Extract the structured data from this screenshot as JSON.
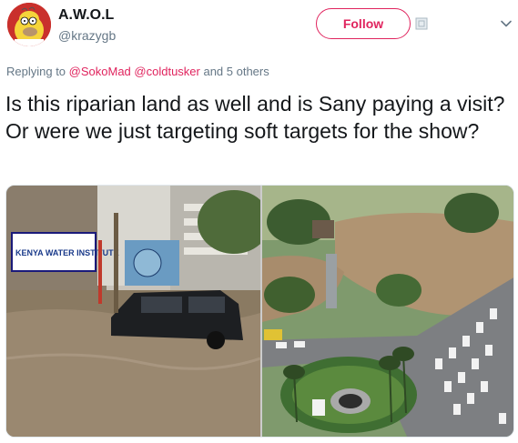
{
  "user": {
    "name": "A.W.O.L",
    "handle": "@krazygb"
  },
  "follow_label": "Follow",
  "reply": {
    "prefix": "Replying to ",
    "mention1": "@SokoMad",
    "mention2": "@coldtusker",
    "suffix": " and 5 others"
  },
  "tweet_text": "Is this riparian land as well and is Sany paying a visit? Or were we just targeting soft targets for the show?",
  "media": {
    "left_photo": {
      "sign_text": "KENYA WATER INSTITUTE"
    },
    "right_photo": {}
  },
  "colors": {
    "accent": "#e0245e",
    "secondary_text": "#657786",
    "primary_text": "#14171a"
  },
  "icons": [
    "avatar-homer",
    "flag-icon",
    "chevron-down-icon"
  ]
}
